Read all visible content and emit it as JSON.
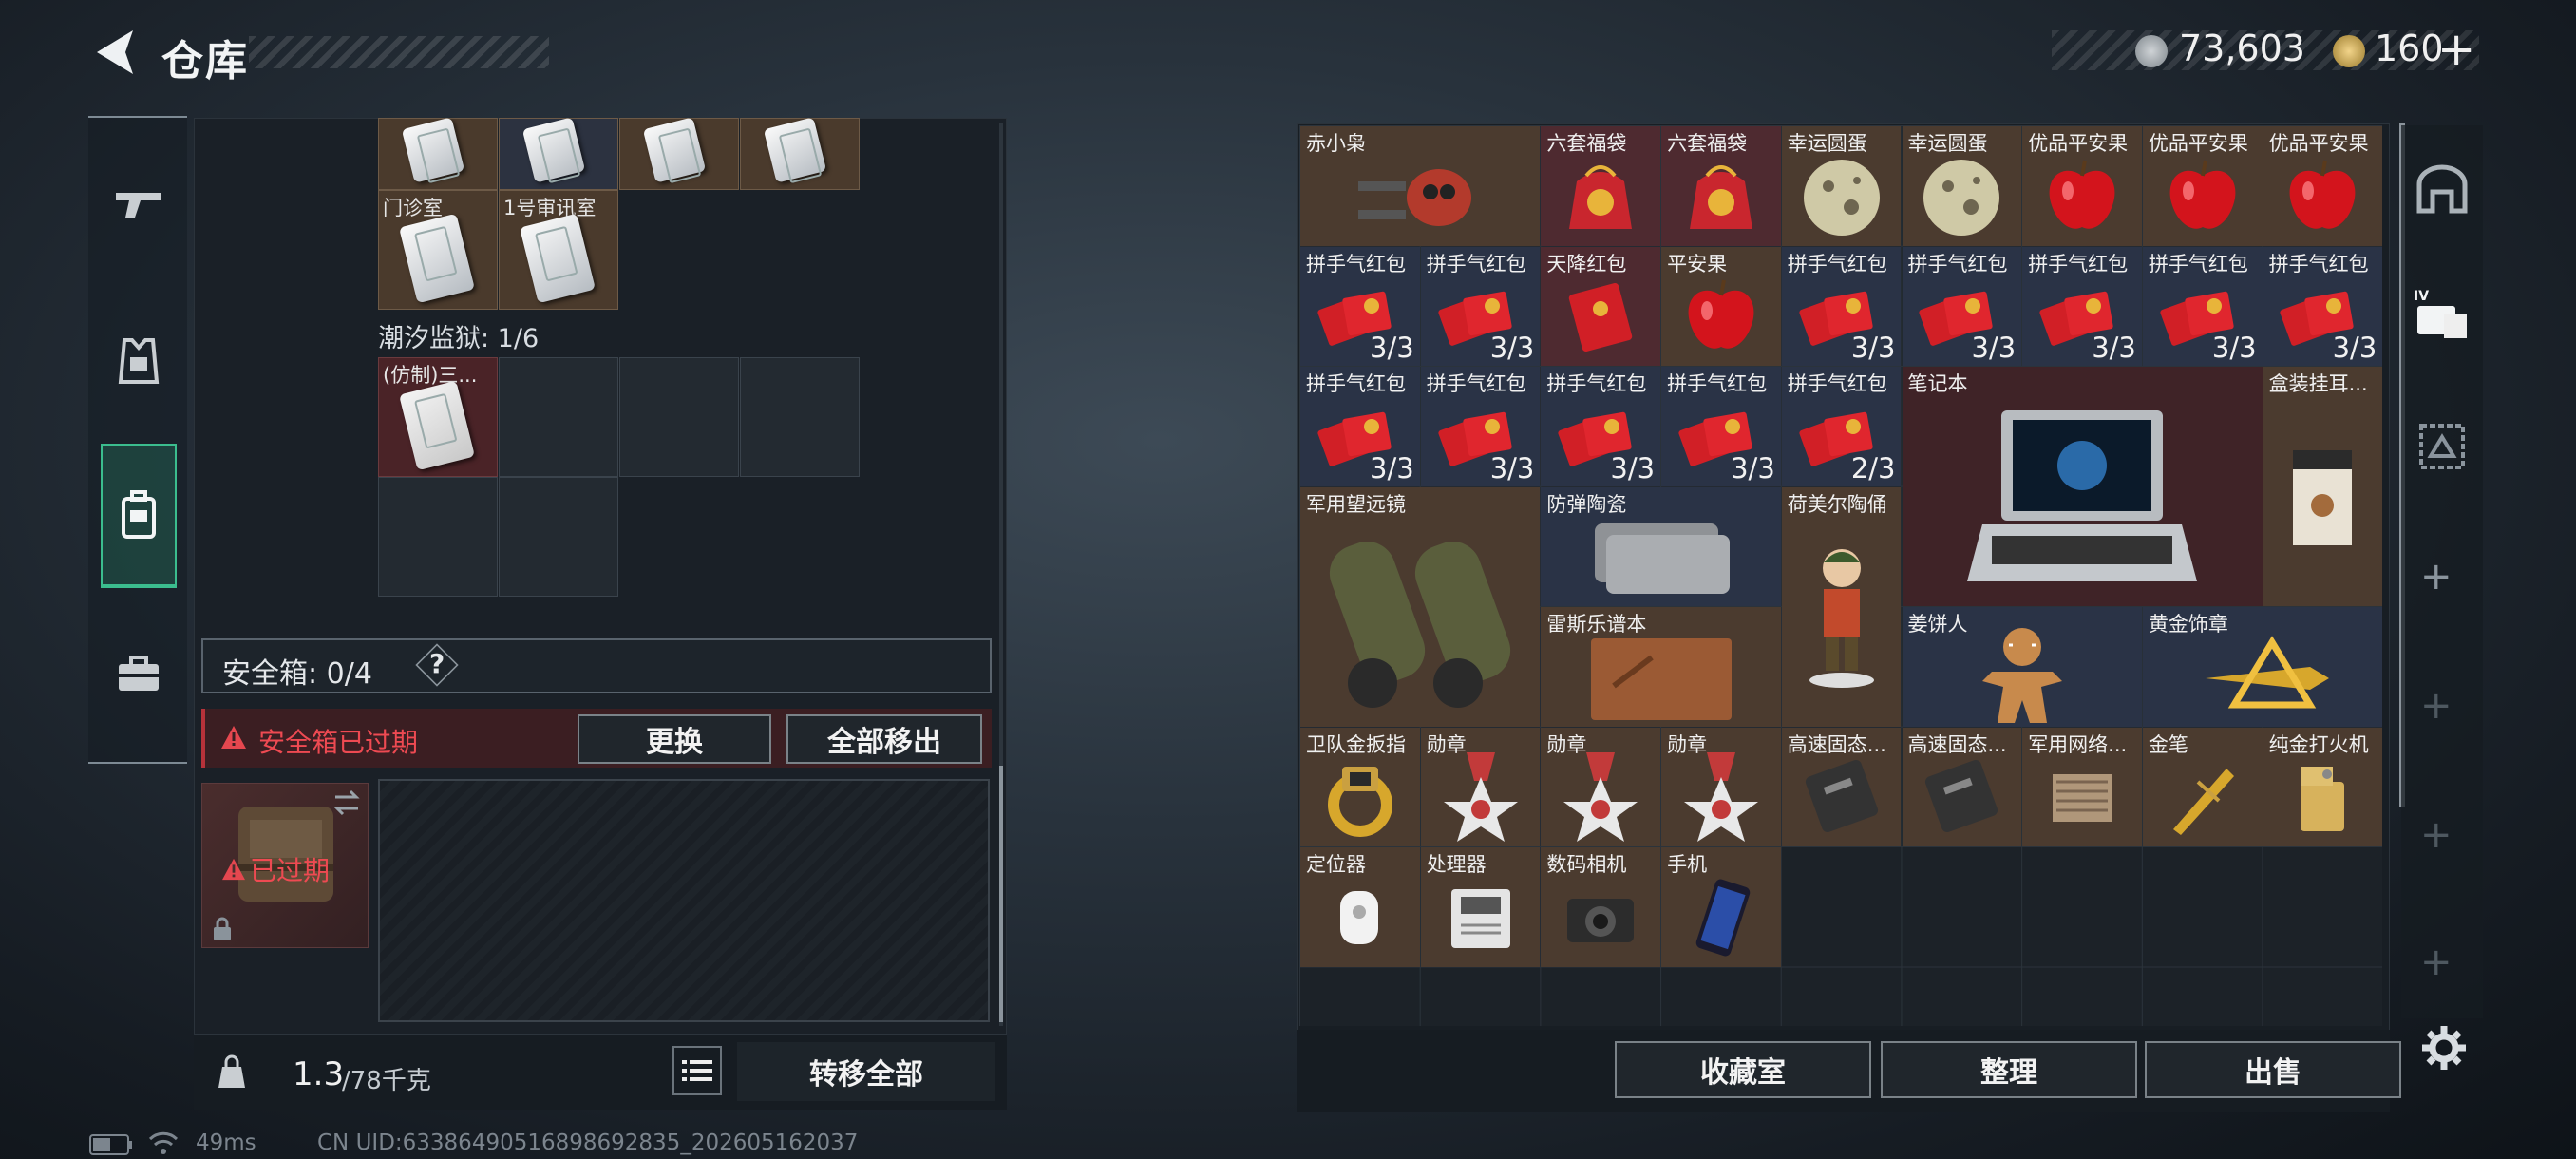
{
  "header": {
    "title": "仓库",
    "currency1": "73,603",
    "currency2": "160",
    "plus": "+"
  },
  "nav": {
    "items": [
      "weapons",
      "equipment",
      "containers",
      "briefcase"
    ],
    "active": "containers"
  },
  "stash": {
    "top_slots": [
      "",
      "",
      "",
      ""
    ],
    "keycards": [
      {
        "label": "门诊室"
      },
      {
        "label": "1号审讯室"
      }
    ],
    "prison_label": "潮汐监狱: 1/6",
    "prison_item": "(仿制)三...",
    "safebox_label": "安全箱: 0/4",
    "safebox_help": "?",
    "expired_warning": "安全箱已过期",
    "replace_label": "更换",
    "move_all_label": "全部移出",
    "case_expired": "已过期",
    "weight": "1.3",
    "weight_cap": "/78千克",
    "transfer_all": "转移全部"
  },
  "inventory": {
    "items": [
      {
        "name": "赤小枭",
        "count": "",
        "icon": "drone"
      },
      {
        "name": "六套福袋",
        "count": "",
        "icon": "lucky-bag"
      },
      {
        "name": "六套福袋",
        "count": "",
        "icon": "lucky-bag"
      },
      {
        "name": "幸运圆蛋",
        "count": "",
        "icon": "egg"
      },
      {
        "name": "幸运圆蛋",
        "count": "",
        "icon": "egg"
      },
      {
        "name": "优品平安果",
        "count": "",
        "icon": "apple"
      },
      {
        "name": "优品平安果",
        "count": "",
        "icon": "apple"
      },
      {
        "name": "优品平安果",
        "count": "",
        "icon": "apple"
      },
      {
        "name": "拼手气红包",
        "count": "3/3",
        "icon": "red-envelopes"
      },
      {
        "name": "拼手气红包",
        "count": "3/3",
        "icon": "red-envelopes"
      },
      {
        "name": "天降红包",
        "count": "",
        "icon": "red-envelope"
      },
      {
        "name": "平安果",
        "count": "",
        "icon": "apple"
      },
      {
        "name": "拼手气红包",
        "count": "3/3",
        "icon": "red-envelopes"
      },
      {
        "name": "拼手气红包",
        "count": "3/3",
        "icon": "red-envelopes"
      },
      {
        "name": "拼手气红包",
        "count": "3/3",
        "icon": "red-envelopes"
      },
      {
        "name": "拼手气红包",
        "count": "3/3",
        "icon": "red-envelopes"
      },
      {
        "name": "拼手气红包",
        "count": "3/3",
        "icon": "red-envelopes"
      },
      {
        "name": "拼手气红包",
        "count": "3/3",
        "icon": "red-envelopes"
      },
      {
        "name": "拼手气红包",
        "count": "3/3",
        "icon": "red-envelopes"
      },
      {
        "name": "拼手气红包",
        "count": "3/3",
        "icon": "red-envelopes"
      },
      {
        "name": "拼手气红包",
        "count": "3/3",
        "icon": "red-envelopes"
      },
      {
        "name": "拼手气红包",
        "count": "2/3",
        "icon": "red-envelopes"
      },
      {
        "name": "笔记本",
        "count": "",
        "icon": "laptop"
      },
      {
        "name": "盒装挂耳...",
        "count": "",
        "icon": "coffee-box"
      },
      {
        "name": "军用望远镜",
        "count": "",
        "icon": "binoculars"
      },
      {
        "name": "防弹陶瓷",
        "count": "",
        "icon": "ceramic-plate"
      },
      {
        "name": "荷美尔陶俑",
        "count": "",
        "icon": "figurine"
      },
      {
        "name": "雷斯乐谱本",
        "count": "",
        "icon": "leather-book"
      },
      {
        "name": "姜饼人",
        "count": "",
        "icon": "gingerbread"
      },
      {
        "name": "黄金饰章",
        "count": "",
        "icon": "gold-badge"
      },
      {
        "name": "卫队金扳指",
        "count": "",
        "icon": "gold-ring"
      },
      {
        "name": "勋章",
        "count": "",
        "icon": "medal"
      },
      {
        "name": "勋章",
        "count": "",
        "icon": "medal"
      },
      {
        "name": "勋章",
        "count": "",
        "icon": "medal"
      },
      {
        "name": "高速固态...",
        "count": "",
        "icon": "ssd"
      },
      {
        "name": "高速固态...",
        "count": "",
        "icon": "ssd"
      },
      {
        "name": "军用网络...",
        "count": "",
        "icon": "network-module"
      },
      {
        "name": "金笔",
        "count": "",
        "icon": "gold-pen"
      },
      {
        "name": "纯金打火机",
        "count": "",
        "icon": "lighter"
      },
      {
        "name": "定位器",
        "count": "",
        "icon": "tracker"
      },
      {
        "name": "处理器",
        "count": "",
        "icon": "processor"
      },
      {
        "name": "数码相机",
        "count": "",
        "icon": "camera"
      },
      {
        "name": "手机",
        "count": "",
        "icon": "phone"
      }
    ],
    "buttons": {
      "collection": "收藏室",
      "organize": "整理",
      "sell": "出售"
    }
  },
  "status": {
    "ping": "49ms",
    "uid": "CN UID:63386490516898692835_202605162037"
  },
  "colors": {
    "accent": "#3bbd8e",
    "warning": "#e5474f"
  }
}
